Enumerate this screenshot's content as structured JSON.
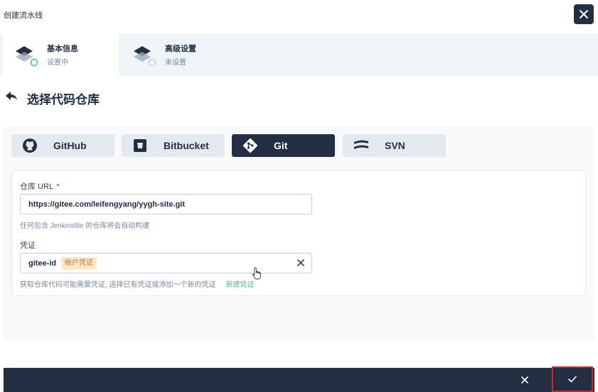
{
  "dialog": {
    "title": "创建流水线"
  },
  "steps": [
    {
      "title": "基本信息",
      "status": "设置中"
    },
    {
      "title": "高级设置",
      "status": "未设置"
    }
  ],
  "section": {
    "title": "选择代码仓库"
  },
  "repo_types": [
    {
      "label": "GitHub",
      "icon": "github-icon",
      "selected": false
    },
    {
      "label": "Bitbucket",
      "icon": "bitbucket-icon",
      "selected": false
    },
    {
      "label": "Git",
      "icon": "git-icon",
      "selected": true
    },
    {
      "label": "SVN",
      "icon": "svn-icon",
      "selected": false
    }
  ],
  "form": {
    "repo_url": {
      "label": "仓库 URL",
      "required_mark": "*",
      "value": "https://gitee.com/leifengyang/yygh-site.git",
      "help": "任何包含 Jenkinsfile 的仓库将会自动构建"
    },
    "credential": {
      "label": "凭证",
      "value": "gitee-id",
      "tag": "帐户凭证",
      "help": "获取仓库代码可能需要凭证, 选择已有凭证或添加一个新的凭证",
      "create_link": "新建凭证"
    }
  },
  "colors": {
    "dark": "#242e42",
    "accent": "#55bc8a",
    "highlight_border": "#d8222a",
    "tag_bg": "#fbe8c7"
  }
}
